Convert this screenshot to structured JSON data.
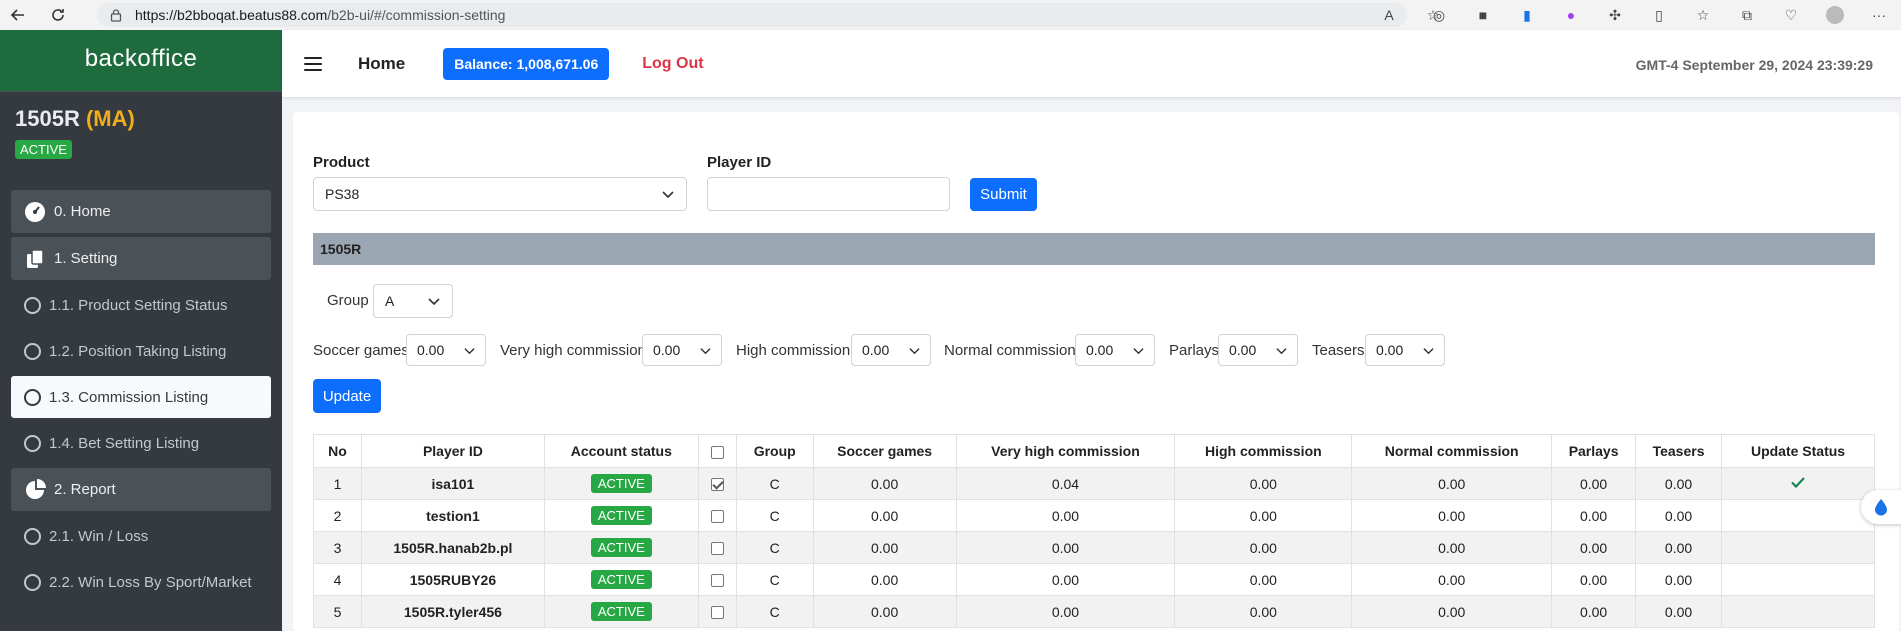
{
  "browser": {
    "url_host": "https://b2bboqat.beatus88.com",
    "url_path": "/b2b-ui/#/commission-setting"
  },
  "sidebar": {
    "brand": "backoffice",
    "user_name": "1505R",
    "user_role": "(MA)",
    "user_status": "ACTIVE",
    "items": [
      {
        "label": "0. Home",
        "icon": "dashboard-icon"
      },
      {
        "label": "1. Setting",
        "icon": "copy-icon"
      },
      {
        "label": "1.1. Product Setting Status"
      },
      {
        "label": "1.2. Position Taking Listing"
      },
      {
        "label": "1.3. Commission Listing"
      },
      {
        "label": "1.4. Bet Setting Listing"
      },
      {
        "label": "2. Report",
        "icon": "pie-chart-icon"
      },
      {
        "label": "2.1. Win / Loss"
      },
      {
        "label": "2.2. Win Loss By Sport/Market"
      }
    ]
  },
  "topbar": {
    "home": "Home",
    "balance": "Balance: 1,008,671.06",
    "logout": "Log Out",
    "clock": "GMT-4 September 29, 2024 23:39:29"
  },
  "filters": {
    "product_label": "Product",
    "product_value": "PS38",
    "player_id_label": "Player ID",
    "player_id_value": "",
    "submit": "Submit"
  },
  "group_header": "1505R",
  "group": {
    "label": "Group",
    "value": "A"
  },
  "commissions": {
    "soccer_label": "Soccer games",
    "soccer_value": "0.00",
    "very_high_label": "Very high commission",
    "very_high_value": "0.00",
    "high_label": "High commission",
    "high_value": "0.00",
    "normal_label": "Normal commission",
    "normal_value": "0.00",
    "parlays_label": "Parlays",
    "parlays_value": "0.00",
    "teasers_label": "Teasers",
    "teasers_value": "0.00",
    "update": "Update"
  },
  "table": {
    "headers": [
      "No",
      "Player ID",
      "Account status",
      "",
      "Group",
      "Soccer games",
      "Very high commission",
      "High commission",
      "Normal commission",
      "Parlays",
      "Teasers",
      "Update Status"
    ],
    "rows": [
      {
        "no": "1",
        "player": "isa101",
        "status": "ACTIVE",
        "checked": true,
        "group": "C",
        "soccer": "0.00",
        "very_high": "0.04",
        "high": "0.00",
        "normal": "0.00",
        "parlays": "0.00",
        "teasers": "0.00",
        "updated": true
      },
      {
        "no": "2",
        "player": "testion1",
        "status": "ACTIVE",
        "checked": false,
        "group": "C",
        "soccer": "0.00",
        "very_high": "0.00",
        "high": "0.00",
        "normal": "0.00",
        "parlays": "0.00",
        "teasers": "0.00",
        "updated": false
      },
      {
        "no": "3",
        "player": "1505R.hanab2b.pl",
        "status": "ACTIVE",
        "checked": false,
        "group": "C",
        "soccer": "0.00",
        "very_high": "0.00",
        "high": "0.00",
        "normal": "0.00",
        "parlays": "0.00",
        "teasers": "0.00",
        "updated": false
      },
      {
        "no": "4",
        "player": "1505RUBY26",
        "status": "ACTIVE",
        "checked": false,
        "group": "C",
        "soccer": "0.00",
        "very_high": "0.00",
        "high": "0.00",
        "normal": "0.00",
        "parlays": "0.00",
        "teasers": "0.00",
        "updated": false
      },
      {
        "no": "5",
        "player": "1505R.tyler456",
        "status": "ACTIVE",
        "checked": false,
        "group": "C",
        "soccer": "0.00",
        "very_high": "0.00",
        "high": "0.00",
        "normal": "0.00",
        "parlays": "0.00",
        "teasers": "0.00",
        "updated": false
      }
    ]
  },
  "colors": {
    "brand_green": "#1e6b3e",
    "primary_blue": "#0d6efd",
    "active_green": "#28a745",
    "logout_red": "#dc3545",
    "role_orange": "#f0ad1c"
  }
}
